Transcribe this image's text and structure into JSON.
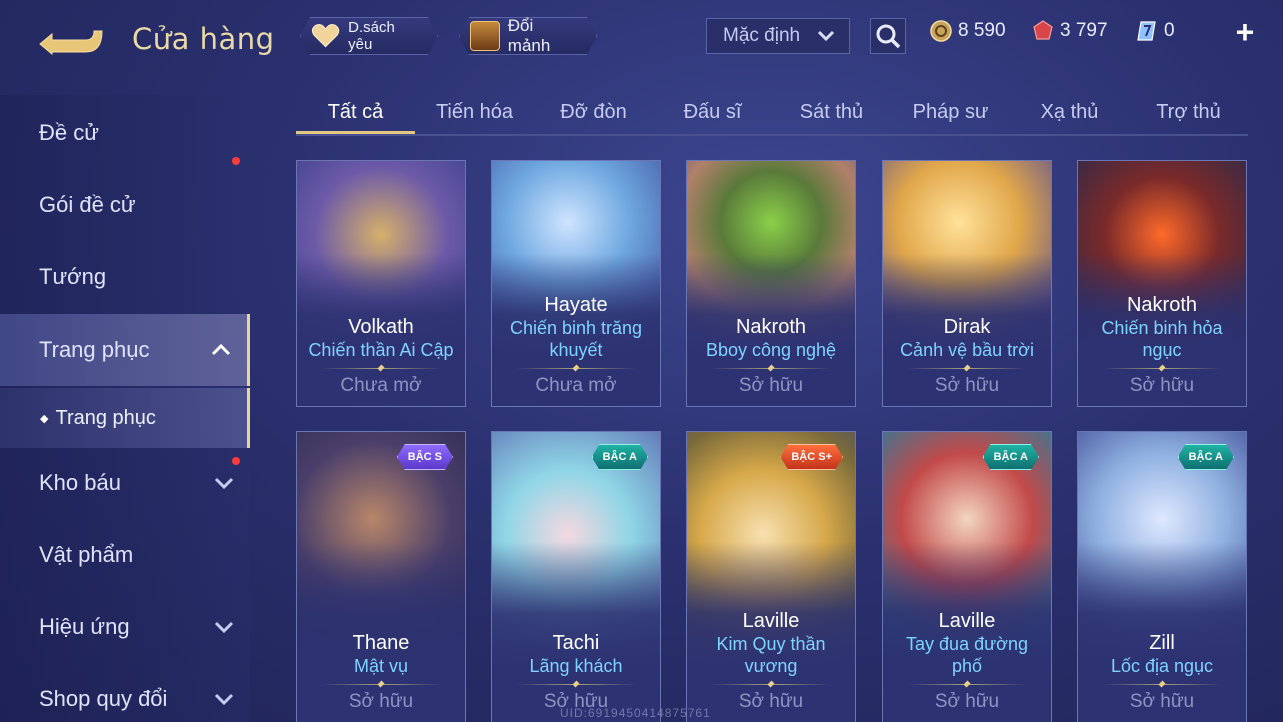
{
  "header": {
    "title": "Cửa hàng",
    "favorites_label": "D.sách yêu",
    "shard_label": "Đổi mảnh",
    "sort_value": "Mặc định",
    "currencies": {
      "gold": "8 590",
      "gems": "3 797",
      "vouchers": "0"
    },
    "add_label": "+"
  },
  "sidebar": {
    "items": [
      {
        "label": "Đề cử"
      },
      {
        "label": "Gói đề cử"
      },
      {
        "label": "Tướng"
      },
      {
        "label": "Trang phục"
      },
      {
        "label": "Kho báu"
      },
      {
        "label": "Vật phẩm"
      },
      {
        "label": "Hiệu ứng"
      },
      {
        "label": "Shop quy đổi"
      }
    ],
    "sub_item": "Trang phục"
  },
  "tabs": [
    "Tất cả",
    "Tiến hóa",
    "Đỡ đòn",
    "Đấu sĩ",
    "Sát thủ",
    "Pháp sư",
    "Xạ thủ",
    "Trợ thủ"
  ],
  "cards": [
    {
      "hero": "Volkath",
      "skin": "Chiến thần Ai Cập",
      "status": "Chưa mở",
      "rank": ""
    },
    {
      "hero": "Hayate",
      "skin": "Chiến binh trăng khuyết",
      "status": "Chưa mở",
      "rank": ""
    },
    {
      "hero": "Nakroth",
      "skin": "Bboy công nghệ",
      "status": "Sở hữu",
      "rank": ""
    },
    {
      "hero": "Dirak",
      "skin": "Cảnh vệ bầu trời",
      "status": "Sở hữu",
      "rank": ""
    },
    {
      "hero": "Nakroth",
      "skin": "Chiến binh hỏa ngục",
      "status": "Sở hữu",
      "rank": ""
    },
    {
      "hero": "Thane",
      "skin": "Mật vụ",
      "status": "Sở hữu",
      "rank": "BẬC S"
    },
    {
      "hero": "Tachi",
      "skin": "Lãng khách",
      "status": "Sở hữu",
      "rank": "BẬC A"
    },
    {
      "hero": "Laville",
      "skin": "Kim Quy thần vương",
      "status": "Sở hữu",
      "rank": "BẬC S+"
    },
    {
      "hero": "Laville",
      "skin": "Tay đua đường phố",
      "status": "Sở hữu",
      "rank": "BẬC A"
    },
    {
      "hero": "Zill",
      "skin": "Lốc địa ngục",
      "status": "Sở hữu",
      "rank": "BẬC A"
    }
  ],
  "uid": "UID:6919450414875761",
  "colors": {
    "accent_gold": "#e9d49a",
    "skin_name": "#7fd3ff",
    "badge_dot": "#ff3b3b"
  },
  "icons": [
    "back-arrow-icon",
    "heart-icon",
    "chest-icon",
    "chevron-down-icon",
    "search-icon",
    "gold-coin-icon",
    "ruby-gem-icon",
    "voucher-icon",
    "plus-icon",
    "chevron-up-icon"
  ]
}
